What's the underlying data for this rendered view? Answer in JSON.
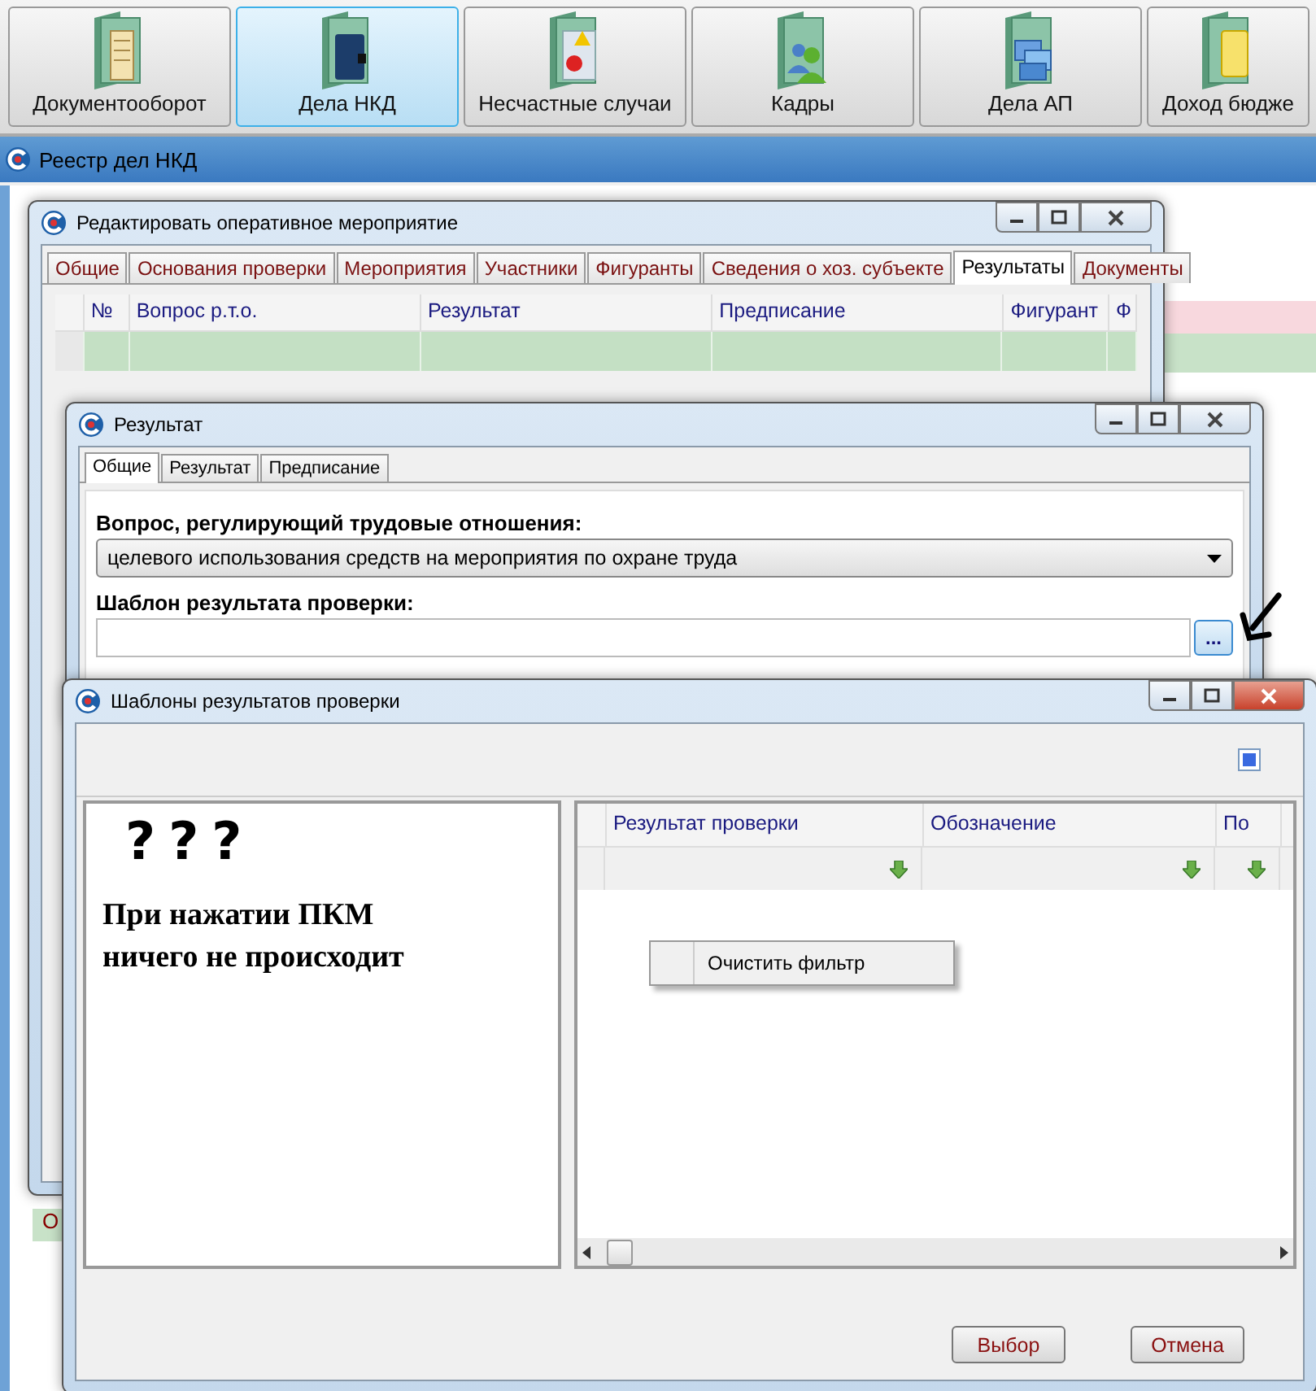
{
  "toolbar": [
    {
      "label": "Документооборот",
      "selected": false
    },
    {
      "label": "Дела НКД",
      "selected": true
    },
    {
      "label": "Несчастные случаи",
      "selected": false
    },
    {
      "label": "Кадры",
      "selected": false
    },
    {
      "label": "Дела АП",
      "selected": false
    },
    {
      "label": "Доход бюдже",
      "selected": false
    }
  ],
  "main_window": {
    "title": "Реестр дел НКД",
    "fragment": "О"
  },
  "edit_window": {
    "title": "Редактировать оперативное мероприятие",
    "tabs": [
      {
        "label": "Общие",
        "selected": false
      },
      {
        "label": "Основания проверки",
        "selected": false
      },
      {
        "label": "Мероприятия",
        "selected": false
      },
      {
        "label": "Участники",
        "selected": false
      },
      {
        "label": "Фигуранты",
        "selected": false
      },
      {
        "label": "Сведения о хоз. субъекте",
        "selected": false
      },
      {
        "label": "Результаты",
        "selected": true
      },
      {
        "label": "Документы",
        "selected": false
      }
    ],
    "grid": {
      "columns": [
        "№",
        "Вопрос р.т.о.",
        "Результат",
        "Предписание",
        "Фигурант",
        "Ф"
      ]
    }
  },
  "result_window": {
    "title": "Результат",
    "tabs": [
      {
        "label": "Общие",
        "selected": true
      },
      {
        "label": "Результат",
        "selected": false
      },
      {
        "label": "Предписание",
        "selected": false
      }
    ],
    "question_label": "Вопрос, регулирующий трудовые отношения:",
    "question_value": "целевого использования средств на мероприятия по охране труда",
    "template_label": "Шаблон результата проверки:",
    "browse_button": "..."
  },
  "templates_window": {
    "title": "Шаблоны результатов проверки",
    "note": {
      "marks": "???",
      "lines": [
        "При нажатии ПКМ",
        "ничего не происходит"
      ]
    },
    "grid": {
      "columns": [
        "Результат проверки",
        "Обозначение",
        "По"
      ]
    },
    "context_menu": [
      {
        "label": "Очистить фильтр"
      }
    ],
    "buttons": [
      "Выбор",
      "Отмена"
    ]
  }
}
